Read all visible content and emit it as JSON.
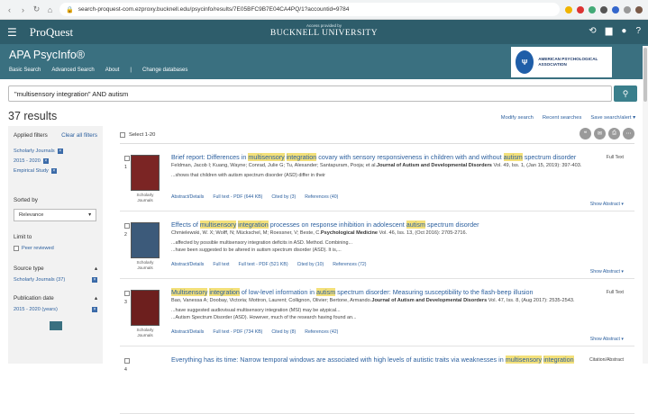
{
  "browser": {
    "url": "search-proquest-com.ezproxy.bucknell.edu/psycinfo/results/7E05BFC9B7E04CA4PQ/1?accountid=9784"
  },
  "header": {
    "logo": "ProQuest",
    "access_text": "Access provided by",
    "university": "BUCKNELL UNIVERSITY"
  },
  "db": {
    "name": "APA PsycInfo®",
    "links": [
      "Basic Search",
      "Advanced Search",
      "About",
      "|",
      "Change databases"
    ],
    "apa_logo_text": "AMERICAN PSYCHOLOGICAL ASSOCIATION"
  },
  "search": {
    "query": "\"multisensory integration\" AND autism"
  },
  "results_count": "37 results",
  "top_links": {
    "modify": "Modify search",
    "recent": "Recent searches",
    "save": "Save search/alert ▾"
  },
  "sidebar": {
    "applied_title": "Applied filters",
    "clear_all": "Clear all filters",
    "applied": [
      "Scholarly Journals",
      "2015 - 2020",
      "Empirical Study"
    ],
    "sorted_by": "Sorted by",
    "sort_value": "Relevance",
    "limit_to": "Limit to",
    "peer_reviewed": "Peer reviewed",
    "source_type": "Source type",
    "source_value": "Scholarly Journals (37)",
    "pub_date": "Publication date",
    "date_value": "2015 - 2020 (years)"
  },
  "select_all": "Select 1-20",
  "results": [
    {
      "num": "1",
      "title_parts": [
        [
          "Brief report: Differences in ",
          0
        ],
        [
          "multisensory",
          1
        ],
        [
          " ",
          0
        ],
        [
          "integration",
          1
        ],
        [
          " covary with sensory responsiveness in children with and without ",
          0
        ],
        [
          "autism",
          1
        ],
        [
          " spectrum disorder",
          0
        ]
      ],
      "authors": "Feldman, Jacob I; Kuang, Wayne; Conrad, Julie G; Tu, Alexander; Santapuram, Pooja; et al.",
      "journal": "Journal of Autism and Developmental Disorders",
      "citation": " Vol. 49, Iss. 1,  (Jan 15, 2019): 397-403.",
      "snippet1": "...shows that children with autism spectrum disorder (ASD) differ in their",
      "snippet2": "",
      "links": [
        "Abstract/Details",
        "Full text - PDF (644 KB)",
        "Cited by (3)",
        "References (40)"
      ],
      "source": "Scholarly Journals",
      "fulltext": "Full Text",
      "show": "Show Abstract ▾"
    },
    {
      "num": "2",
      "title_parts": [
        [
          "Effects of ",
          0
        ],
        [
          "multisensory",
          1
        ],
        [
          " ",
          0
        ],
        [
          "integration",
          1
        ],
        [
          " processes on response inhibition in adolescent ",
          0
        ],
        [
          "autism",
          1
        ],
        [
          " spectrum disorder",
          0
        ]
      ],
      "authors": "Chmielewski, W. X; Wolff, N; Mückschel, M; Roessner, V; Beste, C.",
      "journal": "Psychological Medicine",
      "citation": " Vol. 46, Iss. 13,  (Oct 2016): 2705-2716.",
      "snippet1": "...affected by possible multisensory integration deficits in ASD. Method. Combining...",
      "snippet2": "...have been suggested to be altered in autism spectrum disorder (ASD). It is,...",
      "links": [
        "Abstract/Details",
        "Full text",
        "Full text - PDF (521 KB)",
        "Cited by (10)",
        "References (72)"
      ],
      "source": "Scholarly Journals",
      "fulltext": "",
      "show": "Show Abstract ▾"
    },
    {
      "num": "3",
      "title_parts": [
        [
          "Multisensory",
          1
        ],
        [
          " ",
          0
        ],
        [
          "integration",
          1
        ],
        [
          " of low-level information in ",
          0
        ],
        [
          "autism",
          1
        ],
        [
          " spectrum disorder: Measuring susceptibility to the flash-beep illusion",
          0
        ]
      ],
      "authors": "Bao, Vanessa A; Doobay, Victoria; Mottron, Laurent; Collignon, Olivier; Bertone, Armando.",
      "journal": "Journal of Autism and Developmental Disorders",
      "citation": " Vol. 47, Iss. 8,  (Aug 2017): 2535-2543.",
      "snippet1": "...have suggested audiovisual multisensory integration (MSI) may be atypical...",
      "snippet2": "...Autism Spectrum Disorder (ASD). However, much of the research having found an...",
      "links": [
        "Abstract/Details",
        "Full text - PDF (734 KB)",
        "Cited by (8)",
        "References (42)"
      ],
      "source": "Scholarly Journals",
      "fulltext": "Full Text",
      "show": "Show Abstract ▾"
    },
    {
      "num": "4",
      "title_parts": [
        [
          "Everything has its time: Narrow temporal windows are associated with high levels of autistic traits via weaknesses in ",
          0
        ],
        [
          "multisensory",
          1
        ],
        [
          " ",
          0
        ],
        [
          "integration",
          1
        ]
      ],
      "authors": "",
      "journal": "",
      "citation": "",
      "snippet1": "",
      "snippet2": "",
      "links": [],
      "source": "",
      "fulltext": "Citation/Abstract",
      "show": ""
    }
  ]
}
